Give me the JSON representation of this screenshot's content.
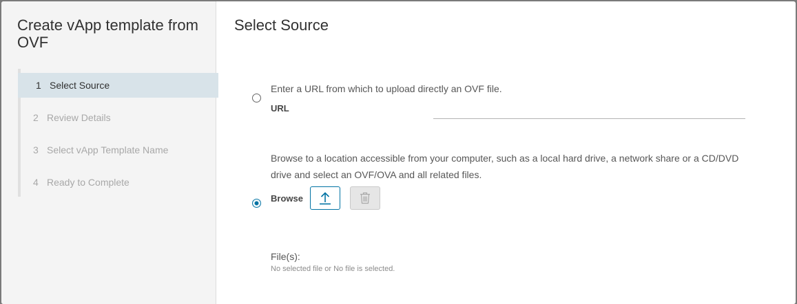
{
  "wizard": {
    "title": "Create vApp template from OVF",
    "steps": [
      {
        "num": "1",
        "label": "Select Source",
        "active": true
      },
      {
        "num": "2",
        "label": "Review Details",
        "active": false
      },
      {
        "num": "3",
        "label": "Select vApp Template Name",
        "active": false
      },
      {
        "num": "4",
        "label": "Ready to Complete",
        "active": false
      }
    ]
  },
  "main": {
    "title": "Select Source",
    "url_option": {
      "description": "Enter a URL from which to upload directly an OVF file.",
      "label": "URL",
      "value": "",
      "selected": false
    },
    "browse_option": {
      "description": "Browse to a location accessible from your computer, such as a local hard drive, a network share or a CD/DVD drive and select an OVF/OVA and all related files.",
      "label": "Browse",
      "selected": true,
      "upload_icon": "upload-icon",
      "delete_icon": "trash-icon"
    },
    "files": {
      "label": "File(s):",
      "status": "No selected file or No file is selected."
    }
  },
  "colors": {
    "accent": "#0072a3",
    "active_step_bg": "#d8e3e9",
    "nav_bg": "#f4f4f4"
  }
}
